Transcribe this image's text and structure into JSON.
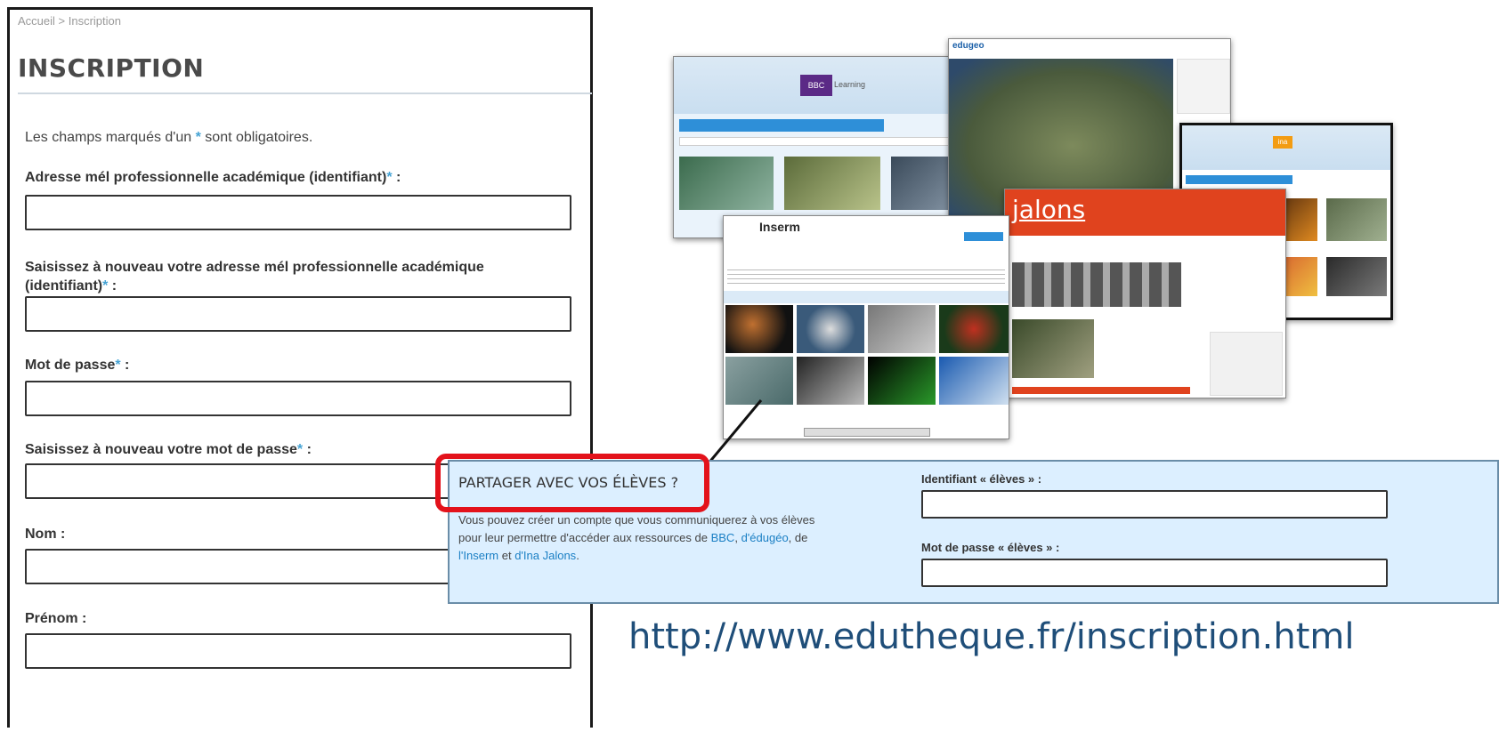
{
  "form": {
    "breadcrumb": "Accueil > Inscription",
    "title": "INSCRIPTION",
    "required_note_pre": "Les champs marqués d'un",
    "required_note_star": "*",
    "required_note_post": "sont obligatoires.",
    "star": "*",
    "fields": {
      "email_label": "Adresse mél professionnelle académique (identifiant)",
      "email_confirm_label_1": "Saisissez à nouveau votre adresse mél professionnelle académique",
      "email_confirm_label_2": "(identifiant)",
      "password_label": "Mot de passe",
      "password_confirm_label": "Saisissez à nouveau votre mot de passe",
      "nom_label": "Nom :",
      "prenom_label": "Prénom :",
      "colon": " :"
    }
  },
  "share": {
    "title": "PARTAGER AVEC VOS ÉLÈVES ?",
    "text_1": "Vous pouvez créer un compte que vous communiquerez à vos élèves",
    "text_2_pre": "pour leur permettre d'accéder aux ressources de",
    "link_bbc": "BBC",
    "sep1": ",",
    "link_edugeo": "d'édugéo",
    "sep2": ", de",
    "link_inserm": "l'Inserm",
    "and": "et",
    "link_ina": "d'Ina Jalons",
    "period": ".",
    "student_id_label": "Identifiant « élèves » :",
    "student_pw_label": "Mot de passe « élèves » :"
  },
  "url": "http://www.edutheque.fr/inscription.html",
  "screenshots": {
    "bbc": {
      "logo": "BBC",
      "tab": "Learning"
    },
    "edugeo": {
      "logo": "edugeo"
    },
    "inserm": {
      "logo": "Inserm"
    },
    "jalons": {
      "logo": "jalons"
    },
    "ina": {
      "logo": "ina"
    }
  },
  "colors": {
    "accent": "#46a3d4",
    "highlight": "#e3121b",
    "share_bg": "#dcefff",
    "url": "#1f4e79"
  }
}
